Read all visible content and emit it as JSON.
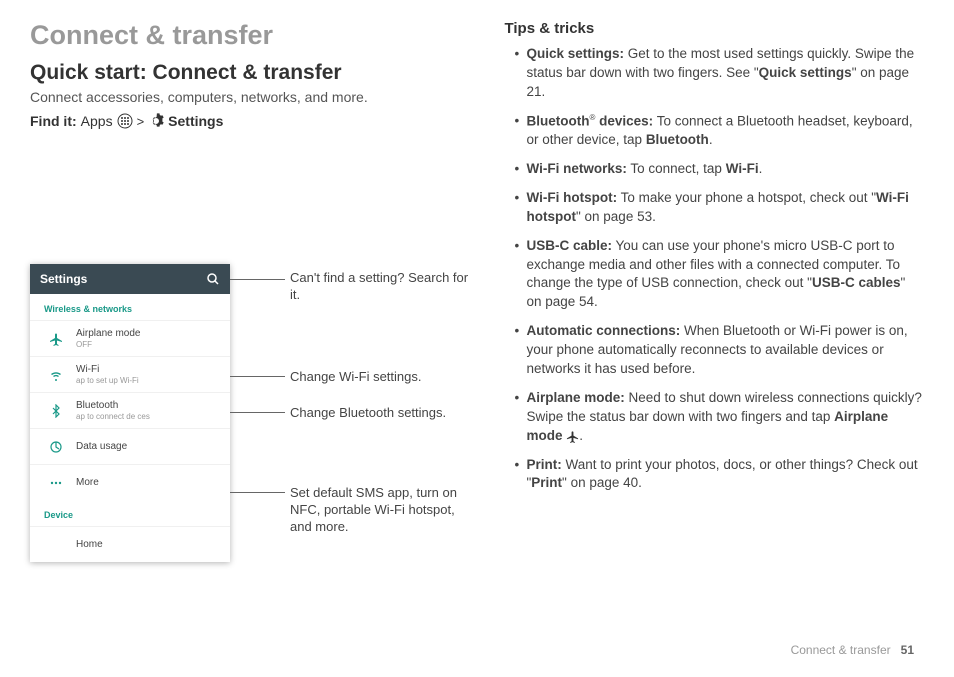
{
  "heading": "Connect & transfer",
  "subheading": "Quick start: Connect & transfer",
  "subtitle": "Connect accessories, computers, networks, and more.",
  "findit": {
    "prefix": "Find it:",
    "apps": "Apps",
    "chev": ">",
    "settings": "Settings"
  },
  "phone": {
    "title": "Settings",
    "section1": "Wireless & networks",
    "airplane": {
      "title": "Airplane mode",
      "sub": "OFF"
    },
    "wifi": {
      "title": "Wi-Fi",
      "sub": "ap to set up Wi-Fi"
    },
    "bt": {
      "title": "Bluetooth",
      "sub": "ap to connect de ces"
    },
    "data": {
      "title": "Data usage"
    },
    "more": {
      "title": "More"
    },
    "section2": "Device",
    "home": {
      "title": "Home"
    }
  },
  "callouts": {
    "search": "Can't find a setting? Search for it.",
    "wifi": "Change Wi-Fi settings.",
    "bt": "Change Bluetooth settings.",
    "more": "Set default SMS app, turn on NFC, portable Wi-Fi hotspot, and more."
  },
  "tips_heading": "Tips & tricks",
  "tips": {
    "quick1": "Quick settings:",
    "quick2": " Get to the most used settings quickly. Swipe the status bar down with two fingers. See \"",
    "quick3": "Quick settings",
    "quick4": "\" on page 21.",
    "bt1": "Bluetooth",
    "bt_reg": "®",
    "bt2": " devices:",
    "bt3": " To connect a Bluetooth headset, keyboard, or other device, tap ",
    "bt4": "Bluetooth",
    "bt5": ".",
    "wifi1": "Wi-Fi networks:",
    "wifi2": " To connect, tap ",
    "wifi3": "Wi-Fi",
    "wifi4": ".",
    "hot1": "Wi-Fi hotspot:",
    "hot2": " To make your phone a hotspot, check out \"",
    "hot3": "Wi-Fi hotspot",
    "hot4": "\" on page 53.",
    "usb1": "USB-C cable:",
    "usb2": " You can use your phone's micro USB-C port to exchange media and other files with a connected computer. To change the type of USB connection, check out \"",
    "usb3": "USB-C cables",
    "usb4": "\" on page 54.",
    "auto1": "Automatic connections:",
    "auto2": " When Bluetooth or Wi-Fi power is on, your phone automatically reconnects to available devices or networks it has used before.",
    "air1": "Airplane mode:",
    "air2": " Need to shut down wireless connections quickly? Swipe the status bar down with two fingers and tap ",
    "air3": "Airplane mode",
    "air4": ".",
    "print1": "Print:",
    "print2": " Want to print your photos, docs, or other things? Check out \"",
    "print3": "Print",
    "print4": "\" on page 40."
  },
  "footer": {
    "title": "Connect & transfer",
    "page": "51"
  }
}
